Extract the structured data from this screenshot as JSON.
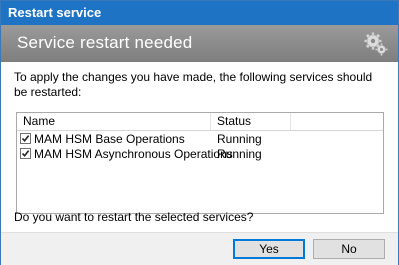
{
  "window": {
    "title": "Restart service"
  },
  "banner": {
    "heading": "Service restart needed",
    "icon": "gear-icon"
  },
  "message": "To apply the changes you have made, the following services should be restarted:",
  "services_list": {
    "columns": [
      "Name",
      "Status"
    ],
    "rows": [
      {
        "name": "MAM HSM Base Operations",
        "status": "Running",
        "checked": true
      },
      {
        "name": "MAM HSM Asynchronous Operations",
        "status": "Running",
        "checked": true
      }
    ]
  },
  "question": "Do you want to restart the selected services?",
  "buttons": {
    "yes": "Yes",
    "no": "No"
  },
  "colors": {
    "titlebar": "#1e73c4",
    "banner": "#8a8a8a",
    "focus": "#0078d7"
  }
}
